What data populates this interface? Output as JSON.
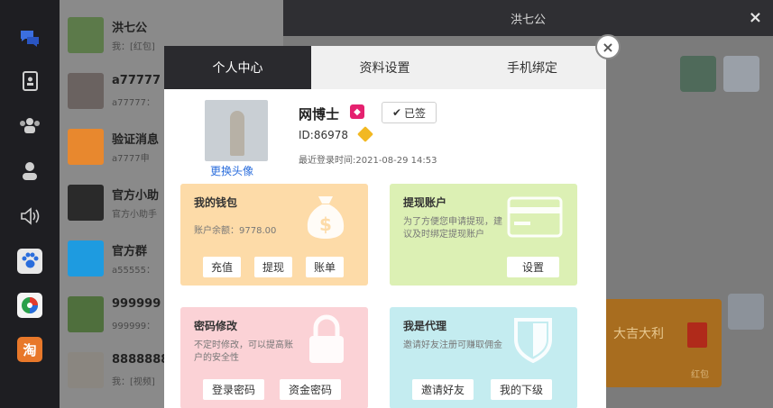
{
  "chat_list": {
    "items": [
      {
        "name": "洪七公",
        "preview": "我：[红包]",
        "color": "#5c7a4a"
      },
      {
        "name": "a77777",
        "preview": "a77777：",
        "color": "#6a6260"
      },
      {
        "name": "验证消息",
        "preview": "a7777申",
        "color": "#e8882e"
      },
      {
        "name": "官方小助",
        "preview": "官方小助手",
        "color": "#2a2a2a"
      },
      {
        "name": "官方群",
        "preview": "a55555：",
        "color": "#1e9be0"
      },
      {
        "name": "999999",
        "preview": "999999：",
        "color": "#4f6f3d"
      },
      {
        "name": "8888888",
        "preview": "我：[视频]",
        "color": "#8a8680"
      }
    ]
  },
  "chat_window": {
    "title": "洪七公",
    "close_glyph": "×",
    "redpacket_text": "大吉大利",
    "redpacket_label": "红包"
  },
  "modal": {
    "close_glyph": "×",
    "tabs": [
      {
        "label": "个人中心",
        "active": true
      },
      {
        "label": "资料设置",
        "active": false
      },
      {
        "label": "手机绑定",
        "active": false
      }
    ],
    "profile": {
      "change_avatar": "更换头像",
      "username": "网博士",
      "signed_label": "已签",
      "user_id": "ID:86978",
      "last_login": "最近登录时间:2021-08-29 14:53"
    },
    "cards": {
      "wallet": {
        "title": "我的钱包",
        "desc": "账户余额：9778.00",
        "buttons": [
          "充值",
          "提现",
          "账单"
        ],
        "color": "#fddba8"
      },
      "withdraw_account": {
        "title": "提现账户",
        "desc": "为了方便您申请提现，建议及时绑定提现账户",
        "buttons": [
          "设置"
        ],
        "color": "#dcf0b4"
      },
      "password": {
        "title": "密码修改",
        "desc": "不定时修改，可以提高账户的安全性",
        "buttons": [
          "登录密码",
          "资金密码"
        ],
        "color": "#fbd2d6"
      },
      "agent": {
        "title": "我是代理",
        "desc": "邀请好友注册可赚取佣金",
        "buttons": [
          "邀请好友",
          "我的下级"
        ],
        "color": "#c4ecf0"
      }
    }
  },
  "icons": {
    "rail": [
      "chat-icon",
      "contacts-book-icon",
      "group-icon",
      "person-icon",
      "speaker-icon",
      "paw-icon",
      "game-icon",
      "shop-icon"
    ],
    "wallet": "dollar-bag-icon",
    "withdraw": "credit-card-icon",
    "password": "lock-icon",
    "agent": "shield-icon"
  }
}
